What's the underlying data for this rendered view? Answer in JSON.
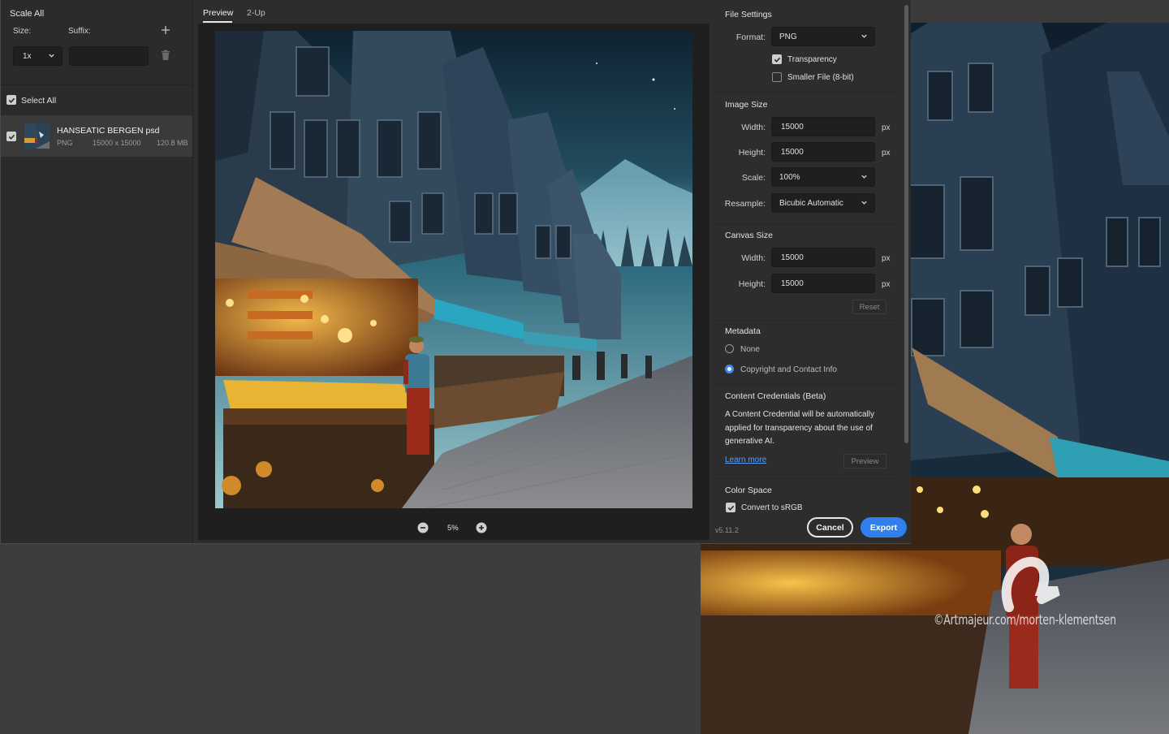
{
  "left_panel": {
    "scale_all": "Scale All",
    "size_label": "Size:",
    "suffix_label": "Suffix:",
    "size_value": "1x",
    "suffix_value": "",
    "select_all": "Select All",
    "select_all_checked": true,
    "asset": {
      "name": "HANSEATIC BERGEN psd",
      "format": "PNG",
      "dimensions": "15000 x 15000",
      "size": "120.8 MB",
      "checked": true
    }
  },
  "preview": {
    "tabs": [
      {
        "label": "Preview",
        "active": true
      },
      {
        "label": "2-Up",
        "active": false
      }
    ],
    "zoom": "5%"
  },
  "settings": {
    "file_settings": {
      "title": "File Settings",
      "format_label": "Format:",
      "format_value": "PNG",
      "transparency_label": "Transparency",
      "transparency_checked": true,
      "smaller_file_label": "Smaller File (8-bit)",
      "smaller_file_checked": false
    },
    "image_size": {
      "title": "Image Size",
      "width_label": "Width:",
      "width_value": "15000",
      "height_label": "Height:",
      "height_value": "15000",
      "scale_label": "Scale:",
      "scale_value": "100%",
      "resample_label": "Resample:",
      "resample_value": "Bicubic Automatic",
      "unit": "px"
    },
    "canvas_size": {
      "title": "Canvas Size",
      "width_label": "Width:",
      "width_value": "15000",
      "height_label": "Height:",
      "height_value": "15000",
      "unit": "px",
      "reset_label": "Reset"
    },
    "metadata": {
      "title": "Metadata",
      "options": [
        {
          "label": "None",
          "selected": false
        },
        {
          "label": "Copyright and Contact Info",
          "selected": true
        }
      ]
    },
    "content_credentials": {
      "title": "Content Credentials (Beta)",
      "description": "A Content Credential will be automatically applied for transparency about the use of generative AI.",
      "learn_more": "Learn more",
      "preview_label": "Preview"
    },
    "color_space": {
      "title": "Color Space",
      "convert_label": "Convert to sRGB",
      "convert_checked": true
    }
  },
  "footer": {
    "version": "v5.11.2",
    "cancel_label": "Cancel",
    "export_label": "Export"
  },
  "background": {
    "watermark": "©Artmajeur.com/morten-klementsen"
  },
  "colors": {
    "accent": "#2f80ed",
    "panel": "#2d2d2d",
    "field": "#1f1f1f"
  }
}
